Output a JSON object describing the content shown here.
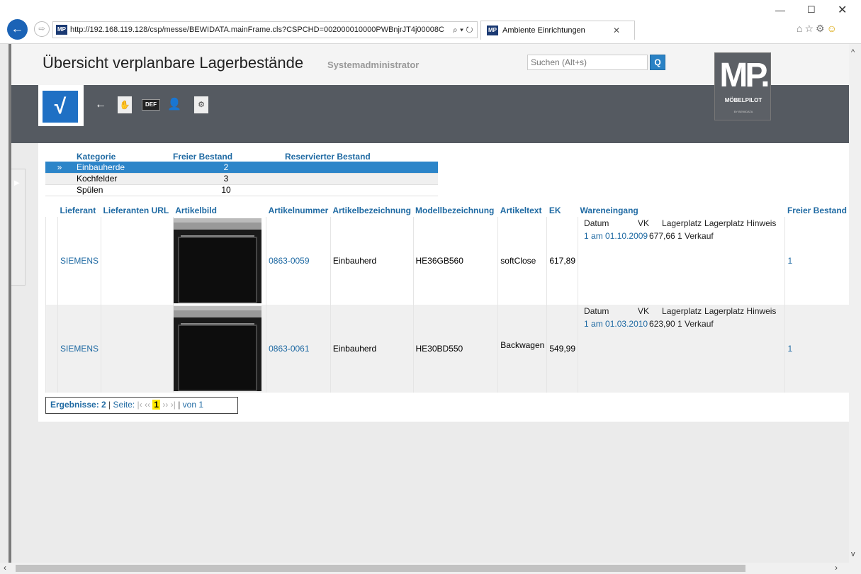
{
  "browser": {
    "url": "http://192.168.119.128/csp/messe/BEWIDATA.mainFrame.cls?CSPCHD=002000010000PWBnjrJT4j00008C",
    "tab_title": "Ambiente Einrichtungen",
    "favicon_text": "MP"
  },
  "header": {
    "title": "Übersicht verplanbare Lagerbestände",
    "user": "Systemadministrator",
    "search_placeholder": "Suchen (Alt+s)",
    "logo_text": "MP.",
    "logo_sub": "MÖBELPILOT",
    "logo_sub2": "BY BEWIDATA"
  },
  "toolbar": {
    "def_label": "DEF"
  },
  "summary": {
    "headers": [
      "Kategorie",
      "Freier Bestand",
      "Reservierter Bestand"
    ],
    "rows": [
      {
        "marker": "»",
        "kategorie": "Einbauherde",
        "frei": "2",
        "reserviert": ""
      },
      {
        "marker": "",
        "kategorie": "Kochfelder",
        "frei": "3",
        "reserviert": ""
      },
      {
        "marker": "",
        "kategorie": "Spülen",
        "frei": "10",
        "reserviert": ""
      }
    ]
  },
  "main": {
    "headers": [
      "Lieferant",
      "Lieferanten URL",
      "Artikelbild",
      "Artikelnummer",
      "Artikelbezeichnung",
      "Modellbezeichnung",
      "Artikeltext",
      "EK",
      "Wareneingang",
      "Freier Bestand"
    ],
    "we_headers": [
      "Datum",
      "VK",
      "Lagerplatz",
      "Lagerplatz Hinweis"
    ],
    "rows": [
      {
        "lieferant": "SIEMENS",
        "url": "",
        "artikelnummer": "0863-0059",
        "bezeichnung": "Einbauherd",
        "modell": "HE36GB560",
        "text": "softClose",
        "ek": "617,89",
        "we_datum": "1 am 01.10.2009",
        "we_vk": "677,66",
        "we_lager": "1 Verkauf",
        "frei": "1"
      },
      {
        "lieferant": "SIEMENS",
        "url": "",
        "artikelnummer": "0863-0061",
        "bezeichnung": "Einbauherd",
        "modell": "HE30BD550",
        "text": "Backwagen",
        "ek": "549,99",
        "we_datum": "1 am 01.03.2010",
        "we_vk": "623,90",
        "we_lager": "1 Verkauf",
        "frei": "1"
      }
    ]
  },
  "pager": {
    "results_label": "Ergebnisse: 2",
    "page_label": "Seite:",
    "first": "|‹",
    "prev": "‹‹",
    "current": "1",
    "next": "››",
    "last": "›|",
    "of_label": "von 1"
  }
}
